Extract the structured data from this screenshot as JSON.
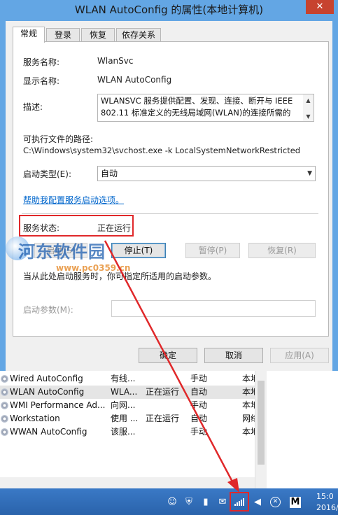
{
  "dialog": {
    "title": "WLAN AutoConfig 的属性(本地计算机)",
    "close_glyph": "✕",
    "tabs": [
      {
        "label": "常规"
      },
      {
        "label": "登录"
      },
      {
        "label": "恢复"
      },
      {
        "label": "依存关系"
      }
    ],
    "general": {
      "service_name_label": "服务名称:",
      "service_name_value": "WlanSvc",
      "display_name_label": "显示名称:",
      "display_name_value": "WLAN AutoConfig",
      "description_label": "描述:",
      "description_line1": "WLANSVC 服务提供配置、发现、连接、断开与 IEEE",
      "description_line2": "802.11 标准定义的无线局域网(WLAN)的连接所需的",
      "exe_path_label": "可执行文件的路径:",
      "exe_path_value": "C:\\Windows\\system32\\svchost.exe -k LocalSystemNetworkRestricted",
      "startup_type_label": "启动类型(E):",
      "startup_type_value": "自动",
      "help_link": "帮助我配置服务启动选项。",
      "status_label": "服务状态:",
      "status_value": "正在运行",
      "start_button": "启动(S)",
      "stop_button": "停止(T)",
      "pause_button": "暂停(P)",
      "resume_button": "恢复(R)",
      "hint_text": "当从此处启动服务时，你可指定所适用的启动参数。",
      "start_params_label": "启动参数(M):"
    },
    "buttons": {
      "ok": "确定",
      "cancel": "取消",
      "apply": "应用(A)"
    }
  },
  "watermark": {
    "text": "河东软件园",
    "url": "www.pc0359.cn"
  },
  "services_list": {
    "rows": [
      {
        "name": "Wired AutoConfig",
        "desc": "有线...",
        "status": "",
        "startup": "手动",
        "logon": "本地"
      },
      {
        "name": "WLAN AutoConfig",
        "desc": "WLA...",
        "status": "正在运行",
        "startup": "自动",
        "logon": "本地"
      },
      {
        "name": "WMI Performance Ad...",
        "desc": "向网...",
        "status": "",
        "startup": "手动",
        "logon": "本地"
      },
      {
        "name": "Workstation",
        "desc": "使用 ...",
        "status": "正在运行",
        "startup": "自动",
        "logon": "网络"
      },
      {
        "name": "WWAN AutoConfig",
        "desc": "该服...",
        "status": "",
        "startup": "手动",
        "logon": "本地"
      }
    ]
  },
  "taskbar": {
    "clock_time": "15:0",
    "clock_date": "2016/",
    "tray_icons": [
      "qq-icon",
      "antivirus-icon",
      "usb-icon",
      "chat-icon",
      "wifi-signal-icon",
      "volume-icon",
      "close-circle-icon",
      "m-icon"
    ],
    "m_label": "M"
  },
  "colors": {
    "highlight": "#e0282a",
    "link": "#0066cc",
    "titlebar": "#63a6e4",
    "taskbar": "#2a63ab"
  }
}
